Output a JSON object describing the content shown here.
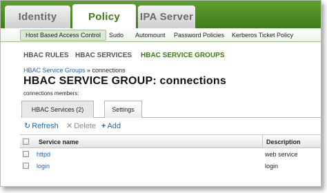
{
  "top_tabs": [
    {
      "label": "Identity",
      "active": false
    },
    {
      "label": "Policy",
      "active": true
    },
    {
      "label": "IPA Server",
      "active": false
    }
  ],
  "sub_nav": [
    {
      "label": "Host Based Access Control",
      "active": true
    },
    {
      "label": "Sudo",
      "active": false
    },
    {
      "label": "Automount",
      "active": false
    },
    {
      "label": "Password Policies",
      "active": false
    },
    {
      "label": "Kerberos Ticket Policy",
      "active": false
    }
  ],
  "section_tabs": [
    {
      "label": "HBAC RULES",
      "active": false
    },
    {
      "label": "HBAC SERVICES",
      "active": false
    },
    {
      "label": "HBAC SERVICE GROUPS",
      "active": true
    }
  ],
  "breadcrumb": {
    "link": "HBAC Service Groups",
    "separator": " » ",
    "current": "connections"
  },
  "page_title": "HBAC SERVICE GROUP: connections",
  "members_label": "connections members:",
  "facet_tabs": [
    {
      "label": "HBAC Services (2)",
      "active": true
    },
    {
      "label": "Settings",
      "active": false
    }
  ],
  "actions": {
    "refresh": "Refresh",
    "delete": "Delete",
    "add": "Add"
  },
  "icons": {
    "refresh": "refresh-icon",
    "delete": "delete-x-icon",
    "add": "plus-icon"
  },
  "table": {
    "columns": [
      "Service name",
      "Description"
    ],
    "rows": [
      {
        "name": "httpd",
        "description": "web service"
      },
      {
        "name": "login",
        "description": "login"
      }
    ]
  },
  "colors": {
    "brand_green": "#3e7a14",
    "link_blue": "#1f62b3"
  }
}
